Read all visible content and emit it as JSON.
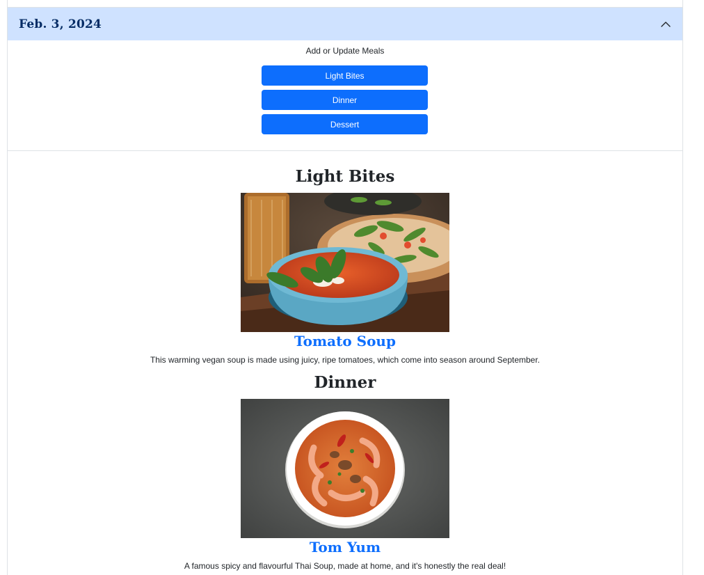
{
  "accordion": {
    "title": "Feb. 3, 2024",
    "toggle_icon": "chevron-up-icon"
  },
  "meals_panel": {
    "caption": "Add or Update Meals",
    "buttons": [
      {
        "label": "Light Bites"
      },
      {
        "label": "Dinner"
      },
      {
        "label": "Dessert"
      }
    ]
  },
  "sections": [
    {
      "heading": "Light Bites",
      "dish": {
        "title": "Tomato Soup",
        "description": "This warming vegan soup is made using juicy, ripe tomatoes, which come into season around September.",
        "image": "tomato-soup-photo"
      }
    },
    {
      "heading": "Dinner",
      "dish": {
        "title": "Tom Yum",
        "description": "A famous spicy and flavourful Thai Soup, made at home, and it's honestly the real deal!",
        "image": "tom-yum-photo"
      }
    }
  ],
  "colors": {
    "accordion_bg": "#cfe2ff",
    "accordion_text": "#052c65",
    "primary": "#0d6efd"
  }
}
